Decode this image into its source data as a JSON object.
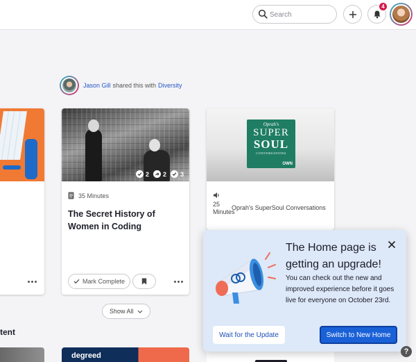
{
  "header": {
    "search_placeholder": "Search",
    "notification_count": "4"
  },
  "shared": {
    "user": "Jason Gill",
    "text": "shared this with",
    "group": "Diversity"
  },
  "cards": {
    "main": {
      "stats": [
        "2",
        "2",
        "3"
      ],
      "duration": "35 Minutes",
      "title": "The Secret History of Women in Coding",
      "mark_complete": "Mark Complete"
    },
    "right": {
      "thumb_lines": [
        "Oprah's",
        "SUPER",
        "SOUL",
        "CONVERSATIONS",
        "OWN"
      ],
      "duration": "25 Minutes",
      "source": "Oprah's SuperSoul Conversations"
    }
  },
  "show_all": "Show All",
  "section_title": "tent",
  "bottom_card_label": "degreed",
  "popup": {
    "title": "The Home page is getting an upgrade!",
    "text": "You can check out the new and improved experience before it goes live for everyone on October 23rd.",
    "wait_label": "Wait for the Update",
    "switch_label": "Switch to New Home"
  },
  "help_label": "?",
  "colors": {
    "accent": "#1a61d8",
    "link": "#2456c7",
    "badge": "#d6174b",
    "popup_bg": "#dde8f8"
  }
}
